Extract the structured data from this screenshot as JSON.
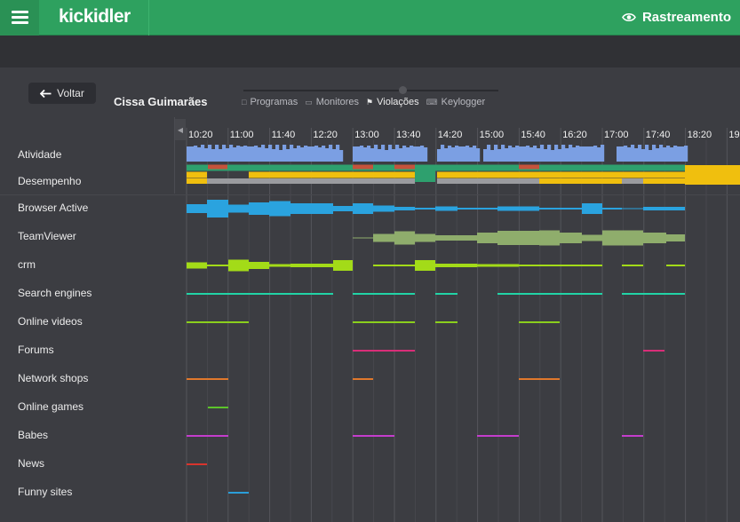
{
  "header": {
    "logo": "kickidler",
    "tracking_label": "Rastreamento"
  },
  "controls": {
    "back_label": "Voltar",
    "user_name": "Cissa Guimarães",
    "tabs": [
      {
        "label": "Programas",
        "icon": "square-icon",
        "active": false
      },
      {
        "label": "Monitores",
        "icon": "monitor-icon",
        "active": false
      },
      {
        "label": "Violações",
        "icon": "flag-icon",
        "active": true
      },
      {
        "label": "Keylogger",
        "icon": "keyboard-icon",
        "active": false
      }
    ]
  },
  "timeline": {
    "time_labels": [
      "10:20",
      "11:00",
      "11:40",
      "12:20",
      "13:00",
      "13:40",
      "14:20",
      "15:00",
      "15:40",
      "16:20",
      "17:00",
      "17:40",
      "18:20",
      "19"
    ],
    "colors": {
      "activity": "#7b9fe3",
      "good": "#2ea06e",
      "bad": "#c4533c",
      "neutral": "#f0bf0e",
      "idle": "#9a9b9f",
      "browser": "#2aa3df",
      "teamviewer": "#8fad6c",
      "crm": "#a3db18",
      "search": "#22d3a6",
      "videos": "#8bcf1d",
      "forums": "#d82e78",
      "shops": "#e0782c",
      "games": "#5cc42a",
      "babes": "#c43dcc",
      "news": "#d8342d",
      "funny": "#2b9ed9"
    },
    "rows": [
      {
        "label": "Atividade"
      },
      {
        "label": "Desempenho"
      },
      {
        "label": "Browser Active"
      },
      {
        "label": "TeamViewer"
      },
      {
        "label": "crm"
      },
      {
        "label": "Search engines"
      },
      {
        "label": "Online videos"
      },
      {
        "label": "Forums"
      },
      {
        "label": "Network shops"
      },
      {
        "label": "Online games"
      },
      {
        "label": "Babes"
      },
      {
        "label": "News"
      },
      {
        "label": "Funny sites"
      }
    ]
  }
}
